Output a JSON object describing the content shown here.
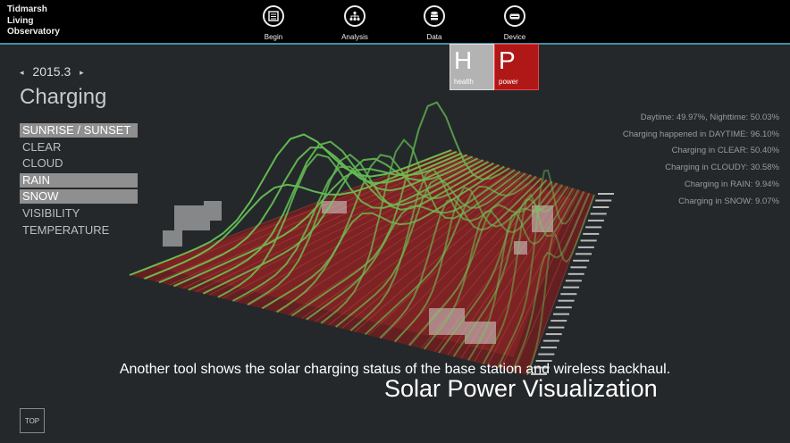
{
  "header": {
    "brand_lines": [
      "Tidmarsh",
      "Living",
      "Observatory"
    ],
    "nav": [
      {
        "label": "Begin",
        "icon": "begin-icon"
      },
      {
        "label": "Analysis",
        "icon": "analysis-icon"
      },
      {
        "label": "Data",
        "icon": "data-icon"
      },
      {
        "label": "Device",
        "icon": "device-icon"
      }
    ]
  },
  "date": {
    "prev": "◂",
    "value": "2015.3",
    "next": "▸"
  },
  "title": "Charging",
  "menu": [
    {
      "label": "SUNRISE / SUNSET",
      "active": true
    },
    {
      "label": "CLEAR",
      "active": false
    },
    {
      "label": "CLOUD",
      "active": false
    },
    {
      "label": "RAIN",
      "active": true
    },
    {
      "label": "SNOW",
      "active": true
    },
    {
      "label": "VISIBILITY",
      "active": false
    },
    {
      "label": "TEMPERATURE",
      "active": false
    }
  ],
  "badges": {
    "health": {
      "letter": "H",
      "label": "health",
      "color": "#b3b3b3"
    },
    "power": {
      "letter": "P",
      "label": "power",
      "color": "#b01818"
    }
  },
  "stats": [
    "Daytime: 49.97%, Nighttime: 50.03%",
    "Charging happened in DAYTIME: 96.10%",
    "Charging in CLEAR: 50.40%",
    "Charging in CLOUDY: 30.58%",
    "Charging in RAIN: 9.94%",
    "Charging in SNOW: 9.07%"
  ],
  "caption": "Another tool shows the solar charging status of the base station and wireless backhaul.",
  "subtitle": "Solar Power Visualization",
  "top_button": "TOP",
  "colors": {
    "accent": "#3a8fa8",
    "curve": "#6fd35a",
    "plane": "#8a1f1f"
  }
}
